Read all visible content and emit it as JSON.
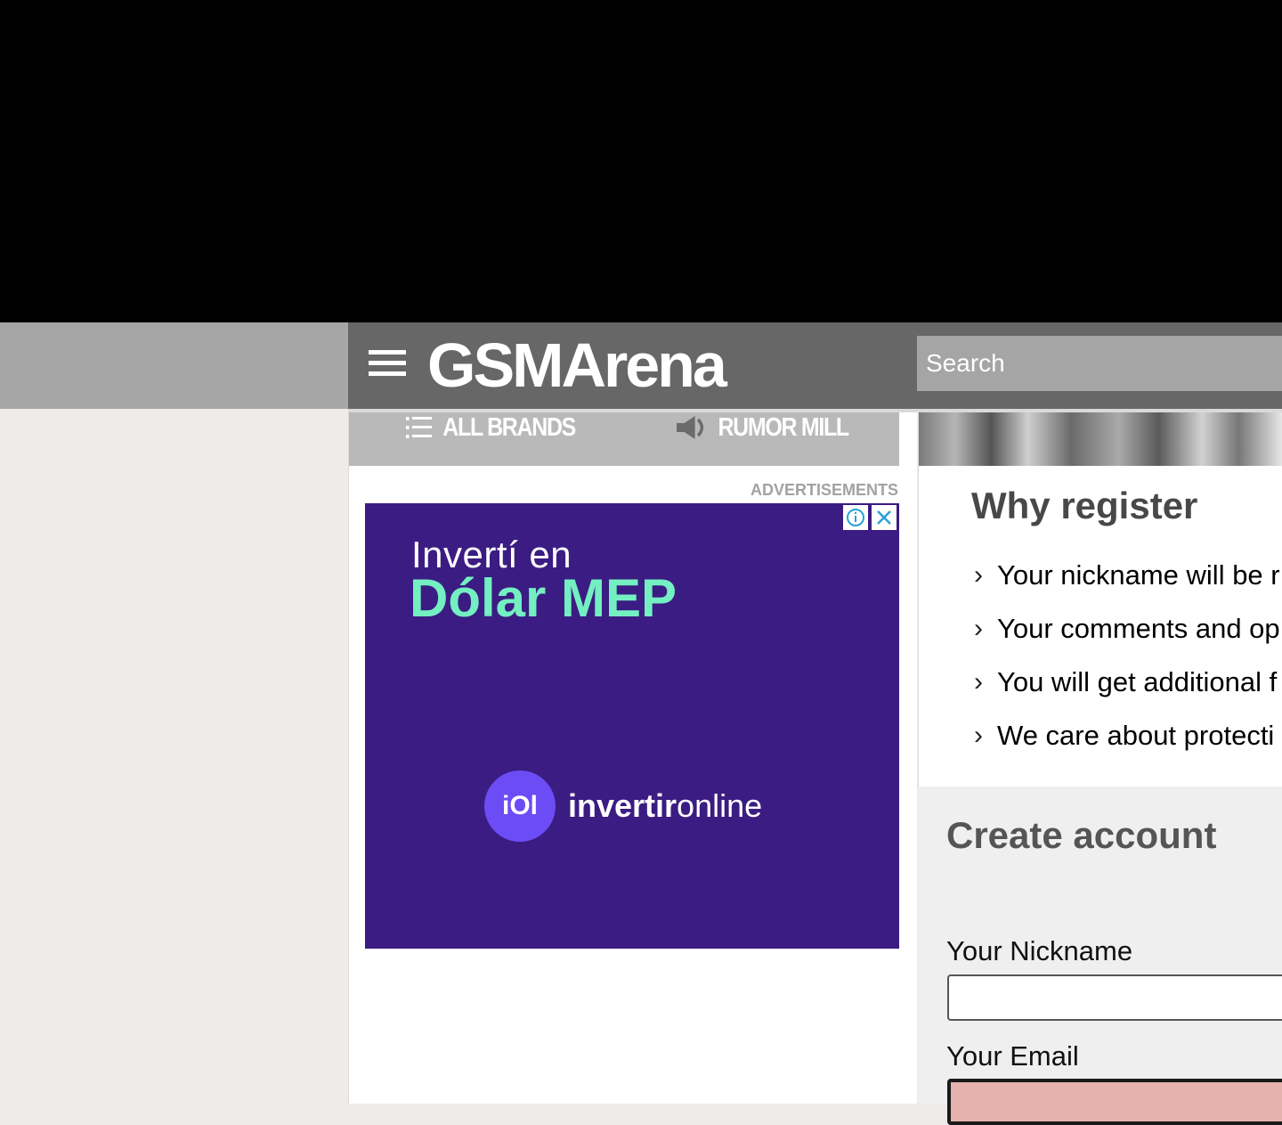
{
  "header": {
    "logo_text": "GSMArena",
    "search_placeholder": "Search"
  },
  "nav": {
    "all_brands": "ALL BRANDS",
    "rumor_mill": "RUMOR MILL"
  },
  "ads": {
    "label": "ADVERTISEMENTS",
    "line1": "Invertí en",
    "line2": "Dólar MEP",
    "logo_mark": "iOl",
    "brand_bold": "invertir",
    "brand_light": "online"
  },
  "why_register": {
    "title": "Why register",
    "items": [
      "Your nickname will be r",
      "Your comments and op",
      "You will get additional f",
      "We care about protecti"
    ]
  },
  "create_account": {
    "title": "Create account",
    "nickname_label": "Your Nickname",
    "email_label": "Your Email"
  },
  "colors": {
    "header_bg": "#676767",
    "ad_bg": "#3b1c82",
    "ad_accent": "#73efc1",
    "email_invalid_bg": "#e5b2ad"
  }
}
